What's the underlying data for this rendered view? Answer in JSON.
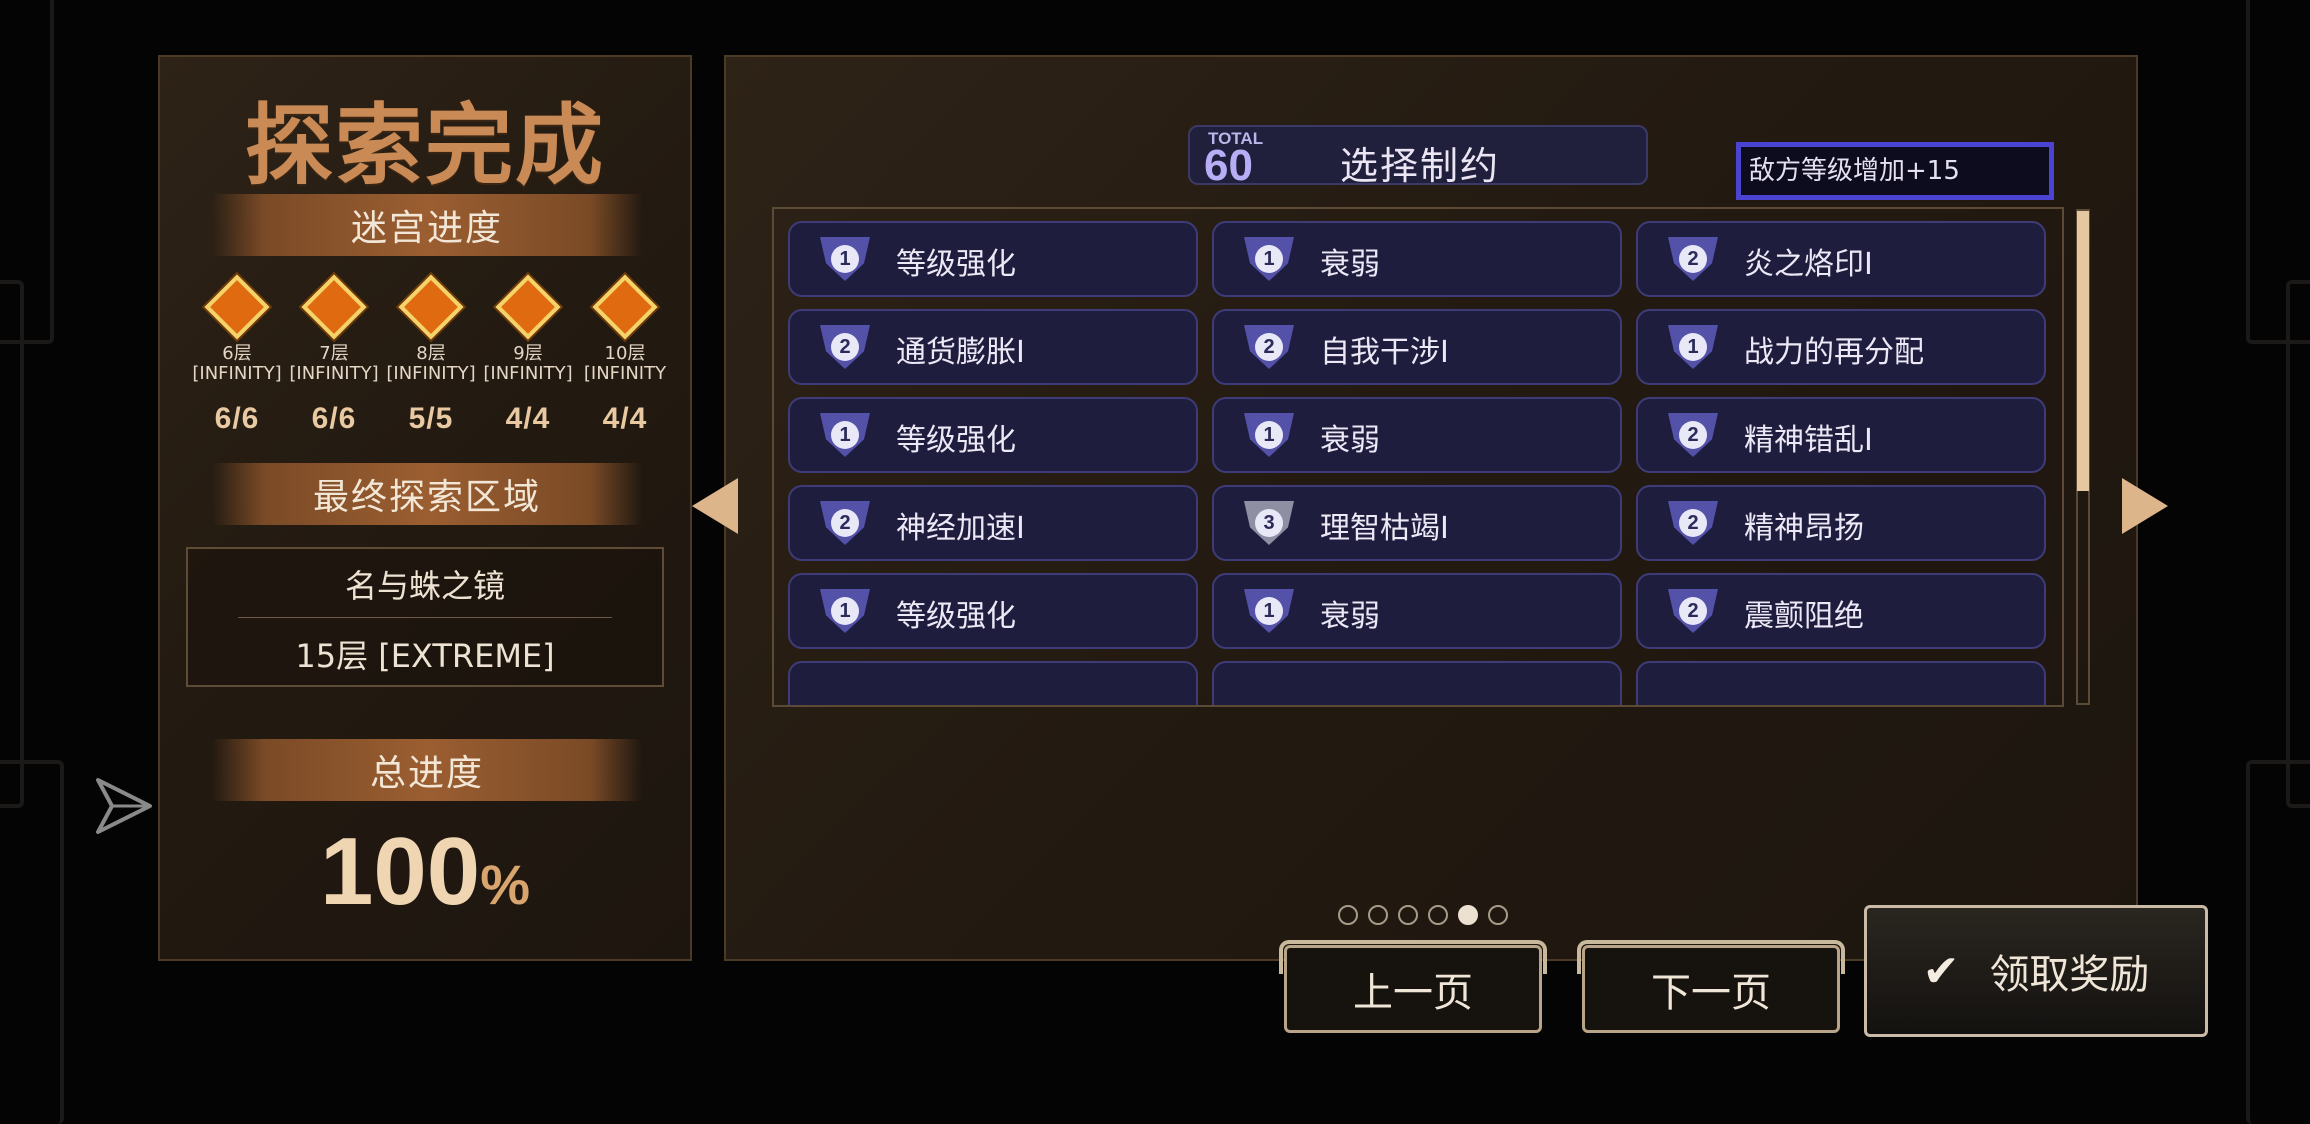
{
  "left_panel": {
    "title": "探索完成",
    "maze_progress_label": "迷宫进度",
    "floors": [
      {
        "name": "6层",
        "mode": "[INFINITY]",
        "count": "6/6"
      },
      {
        "name": "7层",
        "mode": "[INFINITY]",
        "count": "6/6"
      },
      {
        "name": "8层",
        "mode": "[INFINITY]",
        "count": "5/5"
      },
      {
        "name": "9层",
        "mode": "[INFINITY]",
        "count": "4/4"
      },
      {
        "name": "10层",
        "mode": "[INFINITY",
        "count": "4/4"
      }
    ],
    "final_area_label": "最终探索区域",
    "final_area_name": "名与蛛之镜",
    "final_area_floor": "15层 [EXTREME]",
    "total_progress_label": "总进度",
    "total_progress_value": "100",
    "total_progress_unit": "%"
  },
  "restrictions": {
    "total_small": "TOTAL",
    "total_value": "60",
    "title": "选择制约",
    "filter_text": "敌方等级增加+15",
    "items": [
      {
        "level": "1",
        "label": "等级强化"
      },
      {
        "level": "1",
        "label": "衰弱"
      },
      {
        "level": "2",
        "label": "炎之烙印I"
      },
      {
        "level": "2",
        "label": "通货膨胀I"
      },
      {
        "level": "2",
        "label": "自我干涉I"
      },
      {
        "level": "1",
        "label": "战力的再分配"
      },
      {
        "level": "1",
        "label": "等级强化"
      },
      {
        "level": "1",
        "label": "衰弱"
      },
      {
        "level": "2",
        "label": "精神错乱I"
      },
      {
        "level": "2",
        "label": "神经加速I"
      },
      {
        "level": "3",
        "label": "理智枯竭I"
      },
      {
        "level": "2",
        "label": "精神昂扬"
      },
      {
        "level": "1",
        "label": "等级强化"
      },
      {
        "level": "1",
        "label": "衰弱"
      },
      {
        "level": "2",
        "label": "震颤阻绝"
      }
    ],
    "page_count": 6,
    "active_page": 5
  },
  "buttons": {
    "prev": "上一页",
    "next": "下一页",
    "claim": "领取奖励"
  },
  "colors": {
    "accent_orange": "#c98a55",
    "restriction_bg": "#1e1d3e",
    "filter_border": "#4b44d3"
  }
}
